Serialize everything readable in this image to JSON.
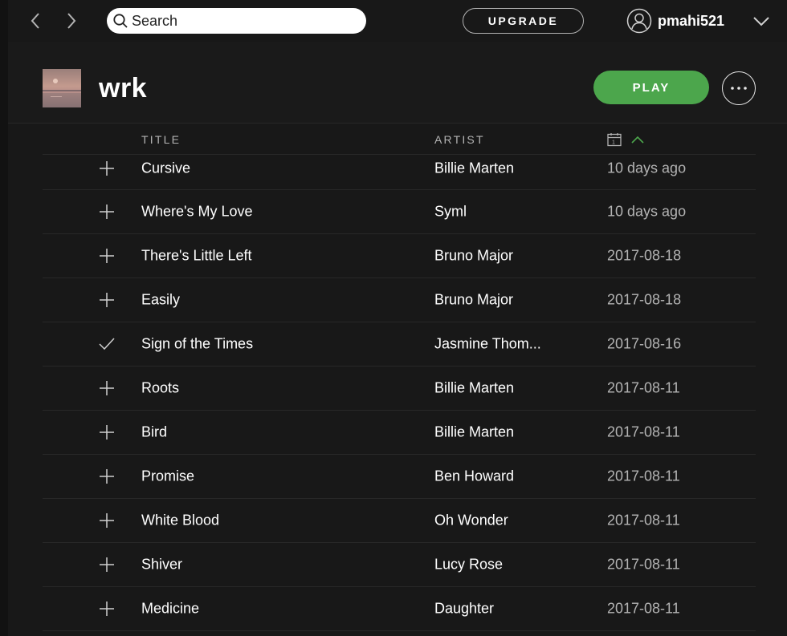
{
  "nav": {
    "back_icon": "chevron-left-icon",
    "forward_icon": "chevron-right-icon"
  },
  "search": {
    "placeholder": "Search",
    "value": "",
    "icon": "search-icon"
  },
  "topbar": {
    "upgrade_label": "UPGRADE",
    "username": "pmahi521",
    "user_icon": "user-icon",
    "menu_icon": "chevron-down-icon"
  },
  "playlist": {
    "title": "wrk",
    "play_label": "PLAY",
    "more_icon": "more-icon"
  },
  "table": {
    "headers": {
      "title": "TITLE",
      "artist": "ARTIST",
      "date_icon": "calendar-icon",
      "sort_icon": "sort-ascending-icon"
    },
    "rows": [
      {
        "title": "Cursive",
        "artist": "Billie Marten",
        "added": "10 days ago",
        "state": "add"
      },
      {
        "title": "Where's My Love",
        "artist": "Syml",
        "added": "10 days ago",
        "state": "add"
      },
      {
        "title": "There's Little Left",
        "artist": "Bruno Major",
        "added": "2017-08-18",
        "state": "add"
      },
      {
        "title": "Easily",
        "artist": "Bruno Major",
        "added": "2017-08-18",
        "state": "add"
      },
      {
        "title": "Sign of the Times",
        "artist": "Jasmine Thom...",
        "added": "2017-08-16",
        "state": "saved"
      },
      {
        "title": "Roots",
        "artist": "Billie Marten",
        "added": "2017-08-11",
        "state": "add"
      },
      {
        "title": "Bird",
        "artist": "Billie Marten",
        "added": "2017-08-11",
        "state": "add"
      },
      {
        "title": "Promise",
        "artist": "Ben Howard",
        "added": "2017-08-11",
        "state": "add"
      },
      {
        "title": "White Blood",
        "artist": "Oh Wonder",
        "added": "2017-08-11",
        "state": "add"
      },
      {
        "title": "Shiver",
        "artist": "Lucy Rose",
        "added": "2017-08-11",
        "state": "add"
      },
      {
        "title": "Medicine",
        "artist": "Daughter",
        "added": "2017-08-11",
        "state": "add"
      }
    ]
  },
  "colors": {
    "background": "#181818",
    "accent": "#4ca64c",
    "text": "#ffffff",
    "muted": "#b3b3b3",
    "divider": "#282828"
  }
}
